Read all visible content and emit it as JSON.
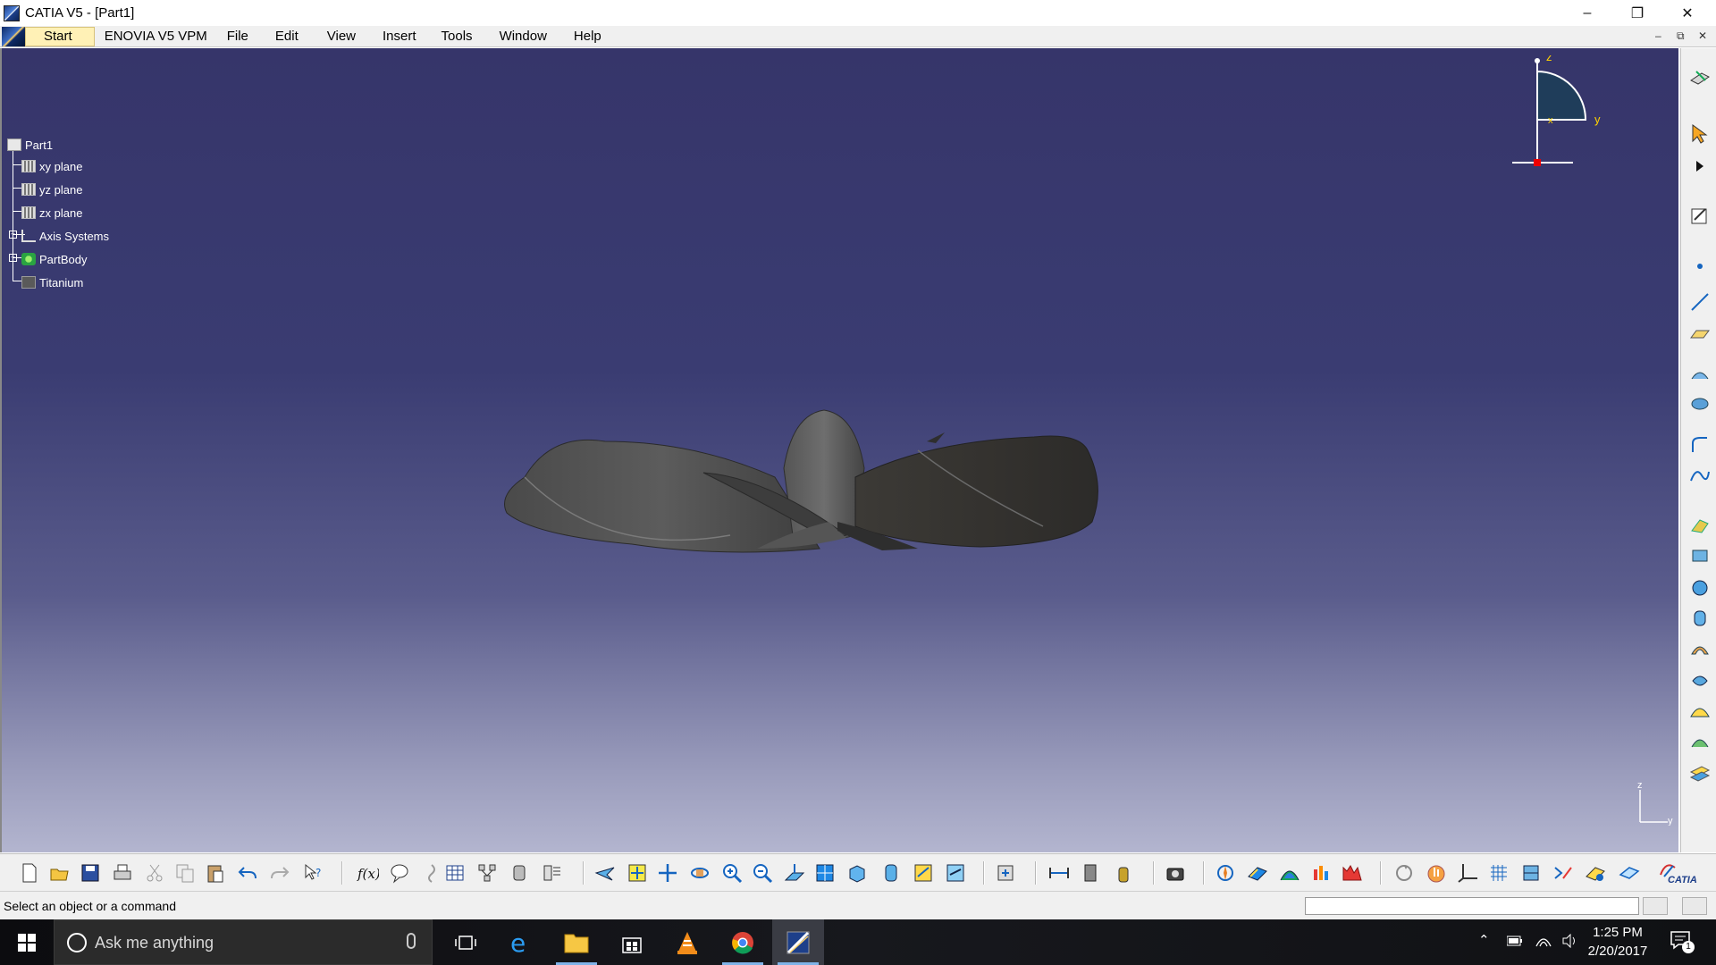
{
  "window": {
    "title": "CATIA V5 - [Part1]",
    "minimize": "–",
    "restore": "❐",
    "close": "✕"
  },
  "menu": {
    "items": [
      "Start",
      "ENOVIA V5 VPM",
      "File",
      "Edit",
      "View",
      "Insert",
      "Tools",
      "Window",
      "Help"
    ],
    "mdi": {
      "minimize": "–",
      "restore": "⧉",
      "close": "✕"
    }
  },
  "tree": {
    "root": "Part1",
    "nodes": [
      "xy plane",
      "yz plane",
      "zx plane",
      "Axis Systems",
      "PartBody",
      "Titanium"
    ]
  },
  "compass": {
    "z": "z",
    "y": "y",
    "x": "x"
  },
  "triad": {
    "z": "z",
    "y": "y"
  },
  "right_toolbar": {
    "icons": [
      "plane-view-icon",
      "select-arrow-icon",
      "expand-arrow-icon",
      "sketcher-icon",
      "point-icon",
      "line-icon",
      "plane-icon",
      "extrude-icon",
      "revolve-icon",
      "corner-icon",
      "spline-icon",
      "pad-icon",
      "pocket-icon",
      "sphere-icon",
      "cylinder-icon",
      "sweep-icon",
      "multi-section-icon",
      "fill-icon",
      "blend-icon",
      "offset-icon"
    ]
  },
  "bottom_toolbar": {
    "icons": [
      "new-icon",
      "open-icon",
      "save-icon",
      "print-icon",
      "cut-icon",
      "copy-icon",
      "paste-icon",
      "undo-icon",
      "redo-icon",
      "whats-this-icon",
      "formula-icon",
      "knowledge-advisor-icon",
      "comment-icon",
      "table-icon",
      "graph-icon",
      "macros-icon",
      "catalog-icon",
      "fly-mode-icon",
      "fit-all-icon",
      "pan-icon",
      "rotate-icon",
      "zoom-in-icon",
      "zoom-out-icon",
      "normal-view-icon",
      "multi-view-icon",
      "iso-view-icon",
      "shading-icon",
      "hide-show-icon",
      "swap-space-icon",
      "publish-icon",
      "measure-between-icon",
      "measure-item-icon",
      "measure-inertia-icon",
      "capture-icon",
      "compass-icon",
      "analysis-icon",
      "surfacic-analysis-icon",
      "curvature-icon",
      "draft-analysis-icon",
      "update-icon",
      "cursor-hand-icon",
      "axis-system-icon",
      "grid-icon",
      "work-on-support-icon",
      "snap-icon",
      "annotation-icon",
      "3d-support-icon",
      "catia-logo-icon"
    ],
    "catia_logo": "CATIA"
  },
  "status": {
    "message": "Select an object or a command",
    "command_value": ""
  },
  "taskbar": {
    "search_placeholder": "Ask me anything",
    "apps": [
      "task-view-icon",
      "edge-icon",
      "file-explorer-icon",
      "store-icon",
      "vlc-icon",
      "chrome-icon",
      "catia-icon"
    ],
    "time": "1:25 PM",
    "date": "2/20/2017",
    "notification_count": "1"
  }
}
